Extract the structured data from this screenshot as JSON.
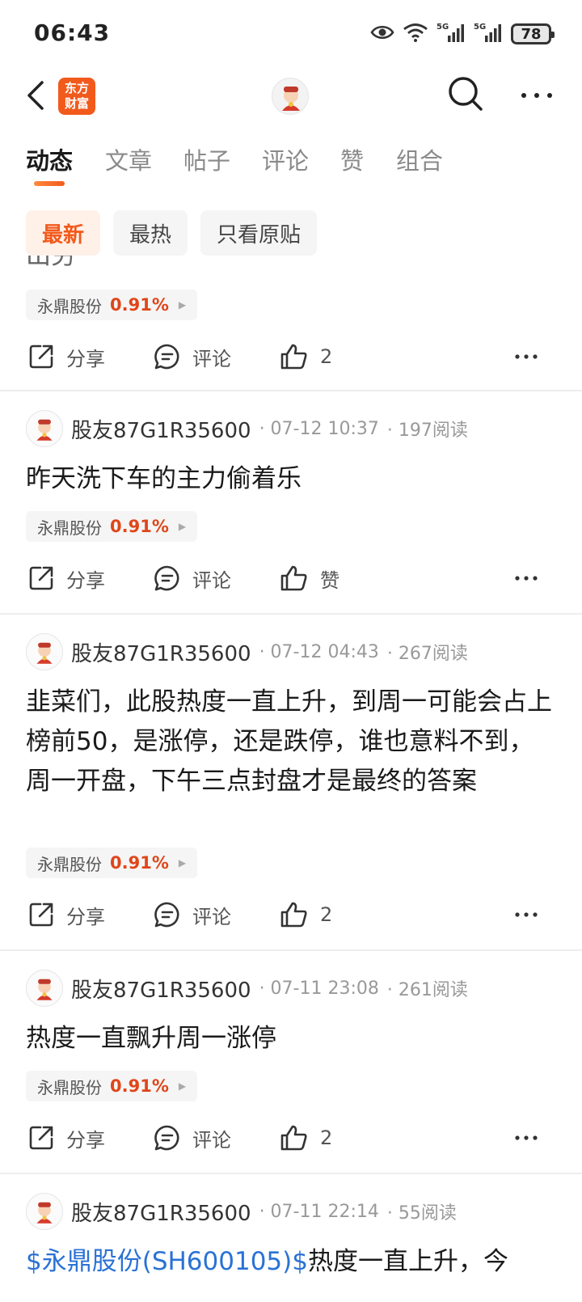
{
  "status_bar": {
    "time": "06:43",
    "battery": "78",
    "network": "5G"
  },
  "header": {
    "logo_text_line1": "东方",
    "logo_text_line2": "财富"
  },
  "tabs": [
    {
      "label": "动态",
      "active": true
    },
    {
      "label": "文章"
    },
    {
      "label": "帖子"
    },
    {
      "label": "评论"
    },
    {
      "label": "赞"
    },
    {
      "label": "组合"
    }
  ],
  "filters": [
    {
      "label": "最新",
      "active": true
    },
    {
      "label": "最热"
    },
    {
      "label": "只看原贴"
    }
  ],
  "actions": {
    "share": "分享",
    "comment": "评论"
  },
  "colors": {
    "brand": "#f25a1c",
    "stock_up": "#e0461a",
    "link": "#2a72d5"
  },
  "posts": [
    {
      "content": "出労",
      "stock": {
        "name": "永鼎股份",
        "change": "0.91%"
      },
      "likes": "2"
    },
    {
      "author": "股友87G1R35600",
      "time": "· 07-12 10:37",
      "reads": "· 197阅读",
      "content": "昨天洗下车的主力偷着乐",
      "stock": {
        "name": "永鼎股份",
        "change": "0.91%"
      },
      "likes": "赞"
    },
    {
      "author": "股友87G1R35600",
      "time": "· 07-12 04:43",
      "reads": "· 267阅读",
      "content": "韭菜们，此股热度一直上升，到周一可能会占上榜前50，是涨停，还是跌停，谁也意料不到，周一开盘，下午三点封盘才是最终的答案",
      "stock": {
        "name": "永鼎股份",
        "change": "0.91%"
      },
      "likes": "2"
    },
    {
      "author": "股友87G1R35600",
      "time": "· 07-11 23:08",
      "reads": "· 261阅读",
      "content": "热度一直飘升周一涨停",
      "stock": {
        "name": "永鼎股份",
        "change": "0.91%"
      },
      "likes": "2"
    },
    {
      "author": "股友87G1R35600",
      "time": "· 07-11 22:14",
      "reads": "· 55阅读",
      "content_link": "$永鼎股份(SH600105)$",
      "content": "热度一直上升，今"
    }
  ]
}
